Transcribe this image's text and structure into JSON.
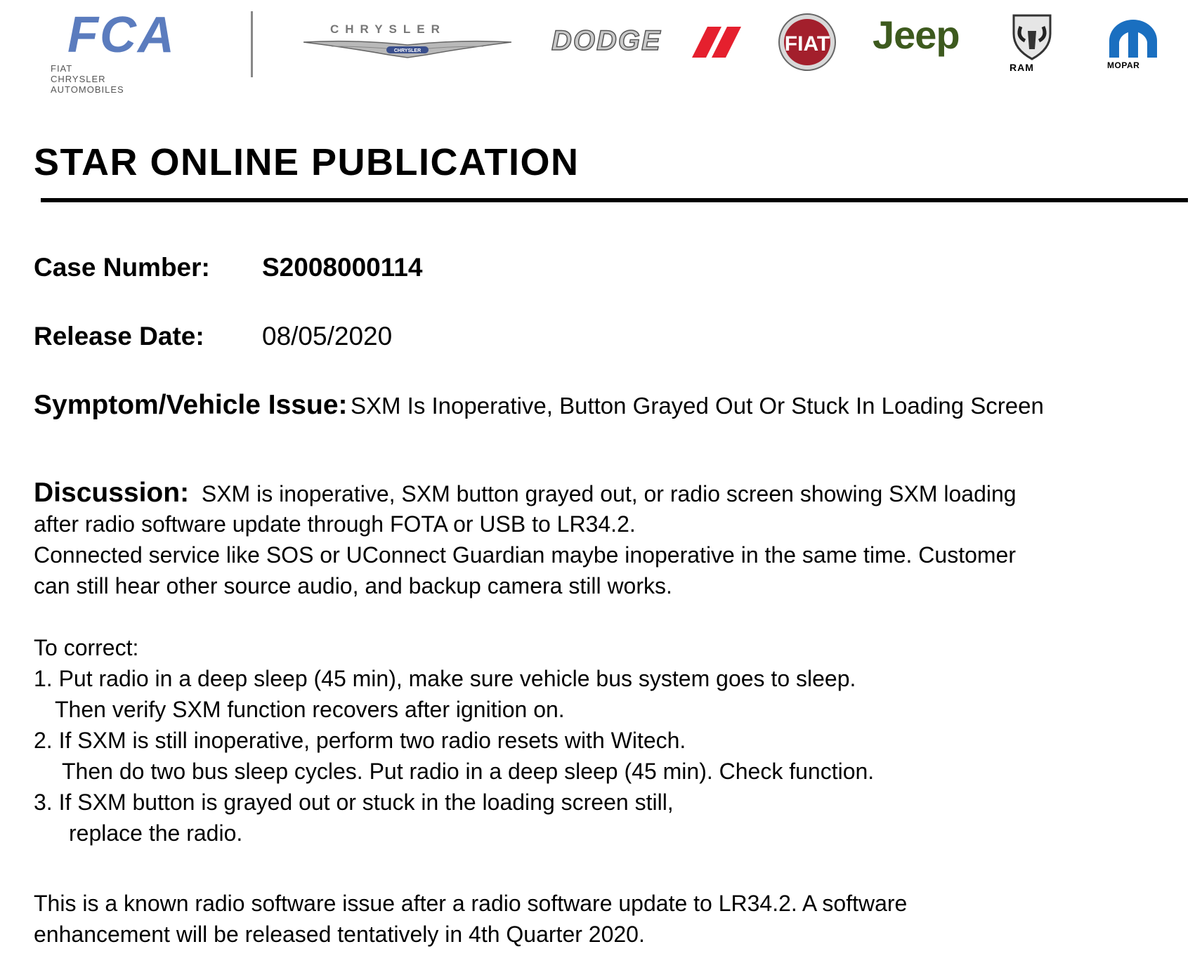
{
  "brands": {
    "fca_word": "FCA",
    "fca_sub": "FIAT CHRYSLER AUTOMOBILES",
    "chrysler_word": "CHRYSLER",
    "chrysler_badge": "CHRYSLER",
    "dodge_word": "DODGE",
    "fiat_word": "FIAT",
    "jeep_word": "Jeep",
    "ram_word": "RAM",
    "mopar_word": "MOPAR"
  },
  "title": "STAR ONLINE PUBLICATION",
  "case": {
    "label": "Case Number:",
    "value": "S2008000114"
  },
  "release": {
    "label": "Release Date:",
    "value": "08/05/2020"
  },
  "symptom": {
    "label": "Symptom/Vehicle Issue:",
    "value": "SXM Is Inoperative, Button Grayed Out Or Stuck In Loading Screen"
  },
  "discussion": {
    "label": "Discussion:",
    "line1": "SXM is inoperative, SXM button grayed out, or radio screen showing SXM loading",
    "line2": "after radio software update through FOTA or USB to LR34.2.",
    "line3": "Connected service like SOS or UConnect Guardian maybe inoperative in the same time. Customer",
    "line4": "can still hear other source audio, and backup camera still works."
  },
  "correct": {
    "heading": "To correct:",
    "step1a": "1. Put radio in a deep sleep (45 min), make sure vehicle bus system goes to sleep.",
    "step1b": "Then verify SXM function recovers after ignition on.",
    "step2a": "2. If SXM is still inoperative, perform two radio resets with Witech.",
    "step2b": "Then do two bus sleep cycles. Put radio in a deep sleep (45 min).  Check function.",
    "step3a": "3. If SXM button is grayed out or stuck in the loading screen still,",
    "step3b": "replace the radio."
  },
  "closing": {
    "line1": "This is a known radio software issue after a radio software update to LR34.2.  A software",
    "line2": "enhancement will be released tentatively in 4th Quarter 2020."
  }
}
